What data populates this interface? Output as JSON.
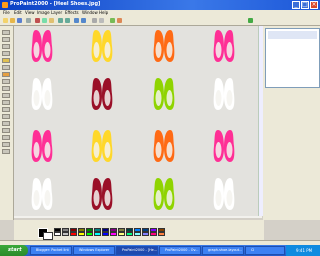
{
  "window": {
    "title": "ProPaint2000 - [Heel Shoes.jpg]"
  },
  "menu": [
    "File",
    "Edit",
    "View",
    "Image",
    "Layer",
    "Effects",
    "Window",
    "Help"
  ],
  "palette_colors": [
    "#000000",
    "#808080",
    "#800000",
    "#808000",
    "#008000",
    "#008080",
    "#000080",
    "#800080",
    "#808040",
    "#004040",
    "#0080ff",
    "#004080",
    "#8000ff",
    "#804000",
    "#ffffff",
    "#c0c0c0",
    "#ff0000",
    "#ffff00",
    "#00ff00",
    "#00ffff",
    "#0000ff",
    "#ff00ff",
    "#ffff80",
    "#00ff80",
    "#80ffff",
    "#8080ff",
    "#ff0080",
    "#ff8040"
  ],
  "shoe_colors": {
    "pink": "#ff2f96",
    "yellow": "#ffd82a",
    "orange": "#ff6a14",
    "white": "#ffffff",
    "darkred": "#9a1028",
    "green": "#8fd400"
  },
  "shoe_grid": [
    [
      "pink",
      "yellow",
      "orange",
      "pink"
    ],
    [
      "white",
      "darkred",
      "green",
      "white"
    ],
    [
      "pink",
      "yellow",
      "orange",
      "pink"
    ],
    [
      "white",
      "darkred",
      "green",
      "white"
    ]
  ],
  "taskbar": {
    "start": "start",
    "tasks": [
      "Blogger: Pocket lint",
      "Windows Explorer",
      "ProPaint2000 - [He...",
      "ProPaint2000 - Ov...",
      "graph-shoe-layout...",
      "Cl"
    ],
    "clock": "9:41 PM"
  }
}
